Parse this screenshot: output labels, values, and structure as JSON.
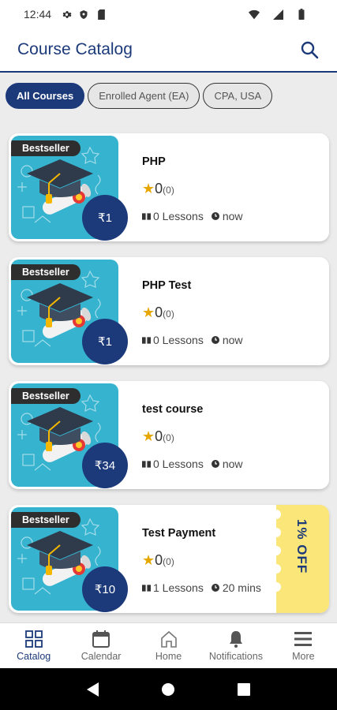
{
  "status_bar": {
    "time": "12:44"
  },
  "app_bar": {
    "title": "Course Catalog"
  },
  "filters": [
    {
      "label": "All Courses",
      "active": true
    },
    {
      "label": "Enrolled Agent (EA)",
      "active": false
    },
    {
      "label": "CPA, USA",
      "active": false
    }
  ],
  "courses": [
    {
      "title": "PHP",
      "badge": "Bestseller",
      "price": "₹1",
      "rating": "0",
      "rating_count": "(0)",
      "lessons": "0 Lessons",
      "duration": "now"
    },
    {
      "title": "PHP Test",
      "badge": "Bestseller",
      "price": "₹1",
      "rating": "0",
      "rating_count": "(0)",
      "lessons": "0 Lessons",
      "duration": "now"
    },
    {
      "title": "test course",
      "badge": "Bestseller",
      "price": "₹34",
      "rating": "0",
      "rating_count": "(0)",
      "lessons": "0 Lessons",
      "duration": "now"
    },
    {
      "title": "Test Payment",
      "badge": "Bestseller",
      "price": "₹10",
      "rating": "0",
      "rating_count": "(0)",
      "lessons": "1 Lessons",
      "duration": "20 mins",
      "discount": "1% OFF"
    }
  ],
  "bottom_nav": [
    {
      "label": "Catalog",
      "icon": "grid-icon",
      "active": true
    },
    {
      "label": "Calendar",
      "icon": "calendar-icon",
      "active": false
    },
    {
      "label": "Home",
      "icon": "home-icon",
      "active": false
    },
    {
      "label": "Notifications",
      "icon": "bell-icon",
      "active": false
    },
    {
      "label": "More",
      "icon": "menu-icon",
      "active": false
    }
  ],
  "colors": {
    "primary": "#1c3a7a",
    "thumb_bg": "#35b3cf",
    "star": "#e6a700",
    "discount_bg": "#fbe67a"
  }
}
